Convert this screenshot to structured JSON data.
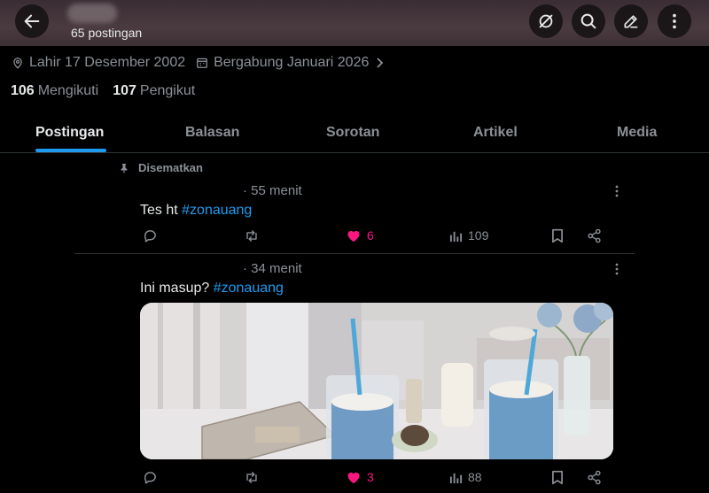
{
  "header": {
    "post_count": "65 postingan"
  },
  "profile": {
    "birth": "Lahir 17 Desember 2002",
    "joined": "Bergabung Januari 2026",
    "following_count": "106",
    "following_label": "Mengikuti",
    "followers_count": "107",
    "followers_label": "Pengikut"
  },
  "tabs": [
    {
      "label": "Postingan",
      "active": true
    },
    {
      "label": "Balasan"
    },
    {
      "label": "Sorotan"
    },
    {
      "label": "Artikel"
    },
    {
      "label": "Media"
    }
  ],
  "posts": [
    {
      "pinned_label": "Disematkan",
      "time": "· 55 menit",
      "text": "Tes ht ",
      "hashtag": "#zonauang",
      "likes": "6",
      "views": "109"
    },
    {
      "time": "· 34 menit",
      "text": "Ini masup? ",
      "hashtag": "#zonauang",
      "likes": "3",
      "views": "88"
    }
  ],
  "colors": {
    "accent": "#1d9bf0",
    "like": "#f91880",
    "muted": "#8b9097",
    "text": "#e7e9ea",
    "background": "#000000"
  },
  "icons": [
    "back-arrow-icon",
    "grok-icon",
    "search-icon",
    "edit-icon",
    "more-vertical-icon",
    "location-icon",
    "calendar-icon",
    "chevron-right-icon",
    "pin-icon",
    "reply-icon",
    "repost-icon",
    "heart-icon",
    "views-icon",
    "bookmark-icon",
    "share-icon"
  ]
}
